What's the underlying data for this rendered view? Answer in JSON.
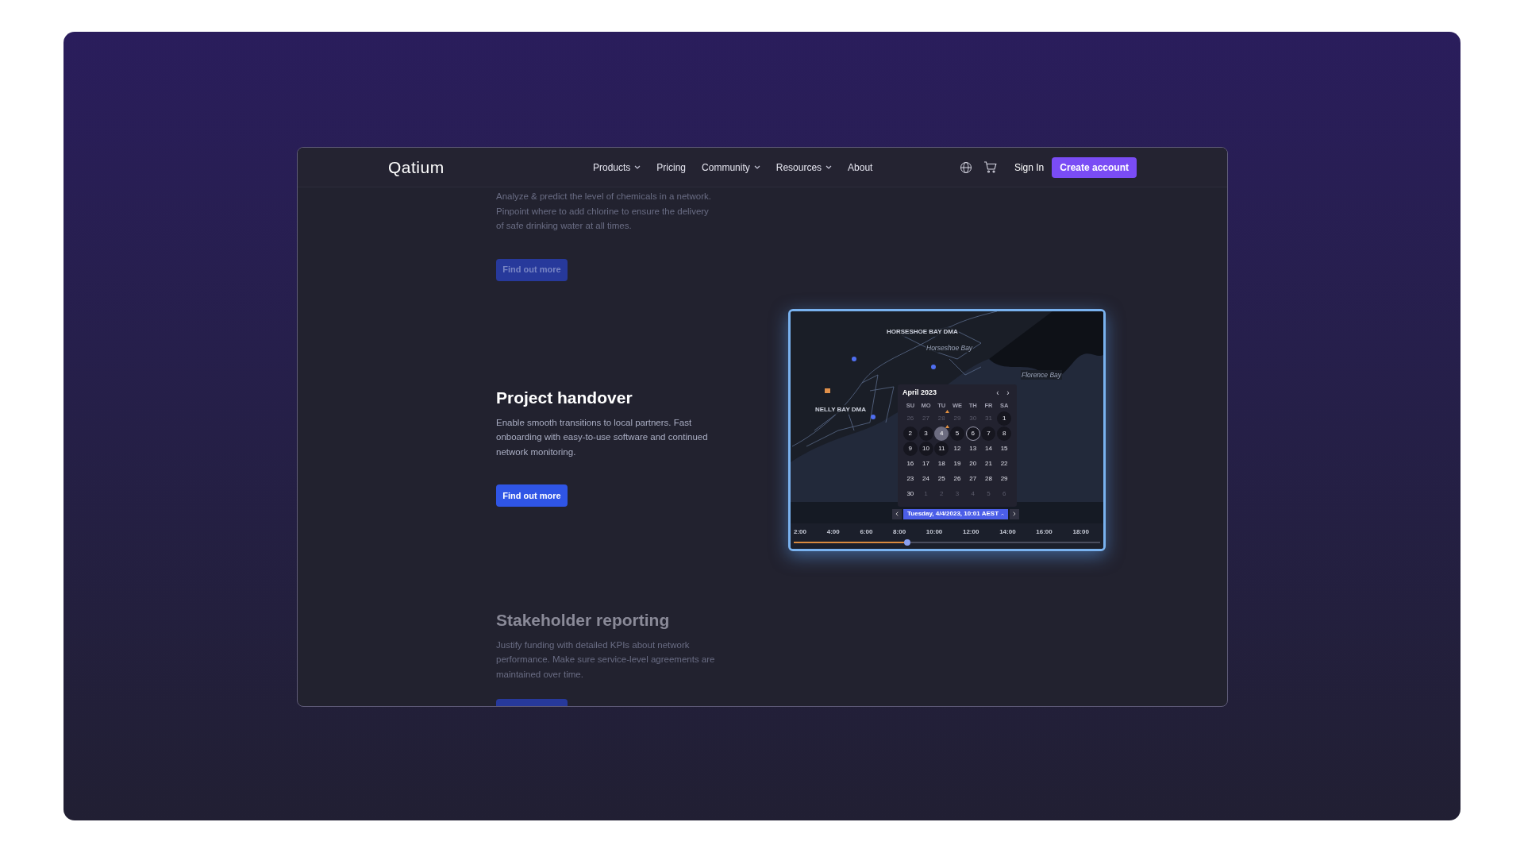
{
  "nav": {
    "logo": "Qatium",
    "links": [
      {
        "label": "Products",
        "dropdown": true
      },
      {
        "label": "Pricing",
        "dropdown": false
      },
      {
        "label": "Community",
        "dropdown": true
      },
      {
        "label": "Resources",
        "dropdown": true
      },
      {
        "label": "About",
        "dropdown": false
      }
    ],
    "sign_in": "Sign In",
    "cta": "Create account"
  },
  "sections": [
    {
      "active": false,
      "text": "Analyze & predict the level of chemicals in a network. Pinpoint where to add chlorine to ensure the delivery of safe drinking water at all times.",
      "button": "Find out more"
    },
    {
      "active": true,
      "heading": "Project handover",
      "text": "Enable smooth transitions to local partners. Fast onboarding with easy-to-use software and continued network monitoring.",
      "button": "Find out more"
    },
    {
      "active": false,
      "heading": "Stakeholder reporting",
      "text": "Justify funding with detailed KPIs about network performance. Make sure service-level agreements are maintained over time.",
      "button_cut_off": true
    }
  ],
  "app_preview": {
    "map_labels": [
      {
        "text": "HORSESHOE BAY DMA",
        "kind": "area"
      },
      {
        "text": "Horseshoe Bay",
        "kind": "place"
      },
      {
        "text": "Florence Bay",
        "kind": "place"
      },
      {
        "text": "NELLY BAY DMA",
        "kind": "area"
      }
    ],
    "calendar": {
      "month": "April 2023",
      "prev": "‹",
      "next": "›",
      "weekdays": [
        "SU",
        "MO",
        "TU",
        "WE",
        "TH",
        "FR",
        "SA"
      ],
      "days": [
        {
          "label": "26",
          "kind": "other",
          "selected": false,
          "ringed": false,
          "warning": false
        },
        {
          "label": "27",
          "kind": "other",
          "selected": false,
          "ringed": false,
          "warning": false
        },
        {
          "label": "28",
          "kind": "other",
          "selected": false,
          "ringed": false,
          "warning": true
        },
        {
          "label": "29",
          "kind": "other",
          "selected": false,
          "ringed": false,
          "warning": false
        },
        {
          "label": "30",
          "kind": "other",
          "selected": false,
          "ringed": false,
          "warning": false
        },
        {
          "label": "31",
          "kind": "other",
          "selected": false,
          "ringed": false,
          "warning": false
        },
        {
          "label": "1",
          "kind": "data",
          "selected": false,
          "ringed": false,
          "warning": false
        },
        {
          "label": "2",
          "kind": "data",
          "selected": false,
          "ringed": false,
          "warning": false
        },
        {
          "label": "3",
          "kind": "data",
          "selected": false,
          "ringed": false,
          "warning": false
        },
        {
          "label": "4",
          "kind": "data",
          "selected": true,
          "ringed": false,
          "warning": true
        },
        {
          "label": "5",
          "kind": "data",
          "selected": false,
          "ringed": false,
          "warning": false
        },
        {
          "label": "6",
          "kind": "data",
          "selected": false,
          "ringed": true,
          "warning": false
        },
        {
          "label": "7",
          "kind": "data",
          "selected": false,
          "ringed": false,
          "warning": false
        },
        {
          "label": "8",
          "kind": "data",
          "selected": false,
          "ringed": false,
          "warning": false
        },
        {
          "label": "9",
          "kind": "data",
          "selected": false,
          "ringed": false,
          "warning": false
        },
        {
          "label": "10",
          "kind": "data",
          "selected": false,
          "ringed": false,
          "warning": false
        },
        {
          "label": "11",
          "kind": "data",
          "selected": false,
          "ringed": false,
          "warning": false
        },
        {
          "label": "12",
          "kind": "plain",
          "selected": false,
          "ringed": false,
          "warning": false
        },
        {
          "label": "13",
          "kind": "plain",
          "selected": false,
          "ringed": false,
          "warning": false
        },
        {
          "label": "14",
          "kind": "plain",
          "selected": false,
          "ringed": false,
          "warning": false
        },
        {
          "label": "15",
          "kind": "plain",
          "selected": false,
          "ringed": false,
          "warning": false
        },
        {
          "label": "16",
          "kind": "plain",
          "selected": false,
          "ringed": false,
          "warning": false
        },
        {
          "label": "17",
          "kind": "plain",
          "selected": false,
          "ringed": false,
          "warning": false
        },
        {
          "label": "18",
          "kind": "plain",
          "selected": false,
          "ringed": false,
          "warning": false
        },
        {
          "label": "19",
          "kind": "plain",
          "selected": false,
          "ringed": false,
          "warning": false
        },
        {
          "label": "20",
          "kind": "plain",
          "selected": false,
          "ringed": false,
          "warning": false
        },
        {
          "label": "21",
          "kind": "plain",
          "selected": false,
          "ringed": false,
          "warning": false
        },
        {
          "label": "22",
          "kind": "plain",
          "selected": false,
          "ringed": false,
          "warning": false
        },
        {
          "label": "23",
          "kind": "plain",
          "selected": false,
          "ringed": false,
          "warning": false
        },
        {
          "label": "24",
          "kind": "plain",
          "selected": false,
          "ringed": false,
          "warning": false
        },
        {
          "label": "25",
          "kind": "plain",
          "selected": false,
          "ringed": false,
          "warning": false
        },
        {
          "label": "26",
          "kind": "plain",
          "selected": false,
          "ringed": false,
          "warning": false
        },
        {
          "label": "27",
          "kind": "plain",
          "selected": false,
          "ringed": false,
          "warning": false
        },
        {
          "label": "28",
          "kind": "plain",
          "selected": false,
          "ringed": false,
          "warning": false
        },
        {
          "label": "29",
          "kind": "plain",
          "selected": false,
          "ringed": false,
          "warning": false
        },
        {
          "label": "30",
          "kind": "plain",
          "selected": false,
          "ringed": false,
          "warning": false
        },
        {
          "label": "1",
          "kind": "other",
          "selected": false,
          "ringed": false,
          "warning": false
        },
        {
          "label": "2",
          "kind": "other",
          "selected": false,
          "ringed": false,
          "warning": false
        },
        {
          "label": "3",
          "kind": "other",
          "selected": false,
          "ringed": false,
          "warning": false
        },
        {
          "label": "4",
          "kind": "other",
          "selected": false,
          "ringed": false,
          "warning": false
        },
        {
          "label": "5",
          "kind": "other",
          "selected": false,
          "ringed": false,
          "warning": false
        },
        {
          "label": "6",
          "kind": "other",
          "selected": false,
          "ringed": false,
          "warning": false
        }
      ]
    },
    "date_button": "Tuesday, 4/4/2023, 10:01 AEST",
    "timeline": {
      "ticks": [
        "2:00",
        "4:00",
        "6:00",
        "8:00",
        "10:00",
        "12:00",
        "14:00",
        "16:00",
        "18:00"
      ],
      "level": 0.37
    }
  }
}
